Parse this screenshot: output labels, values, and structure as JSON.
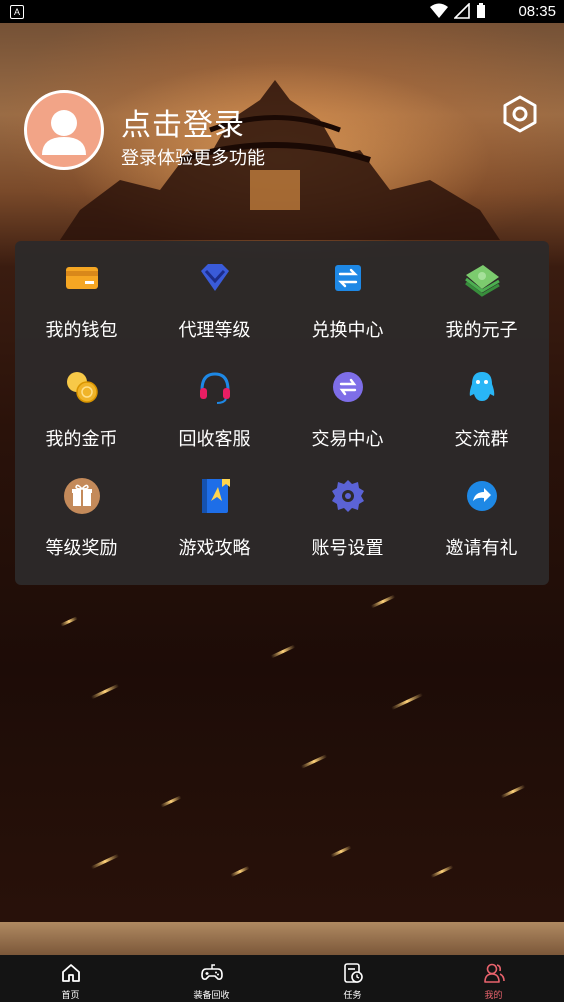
{
  "status_bar": {
    "time": "08:35",
    "app_badge": "A"
  },
  "profile": {
    "title": "点击登录",
    "subtitle": "登录体验更多功能"
  },
  "menu": [
    {
      "label": "我的钱包",
      "icon": "wallet-icon"
    },
    {
      "label": "代理等级",
      "icon": "diamond-icon"
    },
    {
      "label": "兑换中心",
      "icon": "exchange-icon"
    },
    {
      "label": "我的元子",
      "icon": "money-stack-icon"
    },
    {
      "label": "我的金币",
      "icon": "coins-icon"
    },
    {
      "label": "回收客服",
      "icon": "headset-icon"
    },
    {
      "label": "交易中心",
      "icon": "trade-icon"
    },
    {
      "label": "交流群",
      "icon": "penguin-icon"
    },
    {
      "label": "等级奖励",
      "icon": "gift-icon"
    },
    {
      "label": "游戏攻略",
      "icon": "guide-book-icon"
    },
    {
      "label": "账号设置",
      "icon": "gear-icon"
    },
    {
      "label": "邀请有礼",
      "icon": "share-icon"
    }
  ],
  "tabs": [
    {
      "label": "首页",
      "icon": "home-icon"
    },
    {
      "label": "装备回收",
      "icon": "gamepad-icon"
    },
    {
      "label": "任务",
      "icon": "task-icon"
    },
    {
      "label": "我的",
      "icon": "user-icon",
      "active": true
    }
  ],
  "colors": {
    "accent": "#e8636d",
    "avatar_bg": "#f2a487",
    "panel_bg": "#2d2a2a"
  }
}
